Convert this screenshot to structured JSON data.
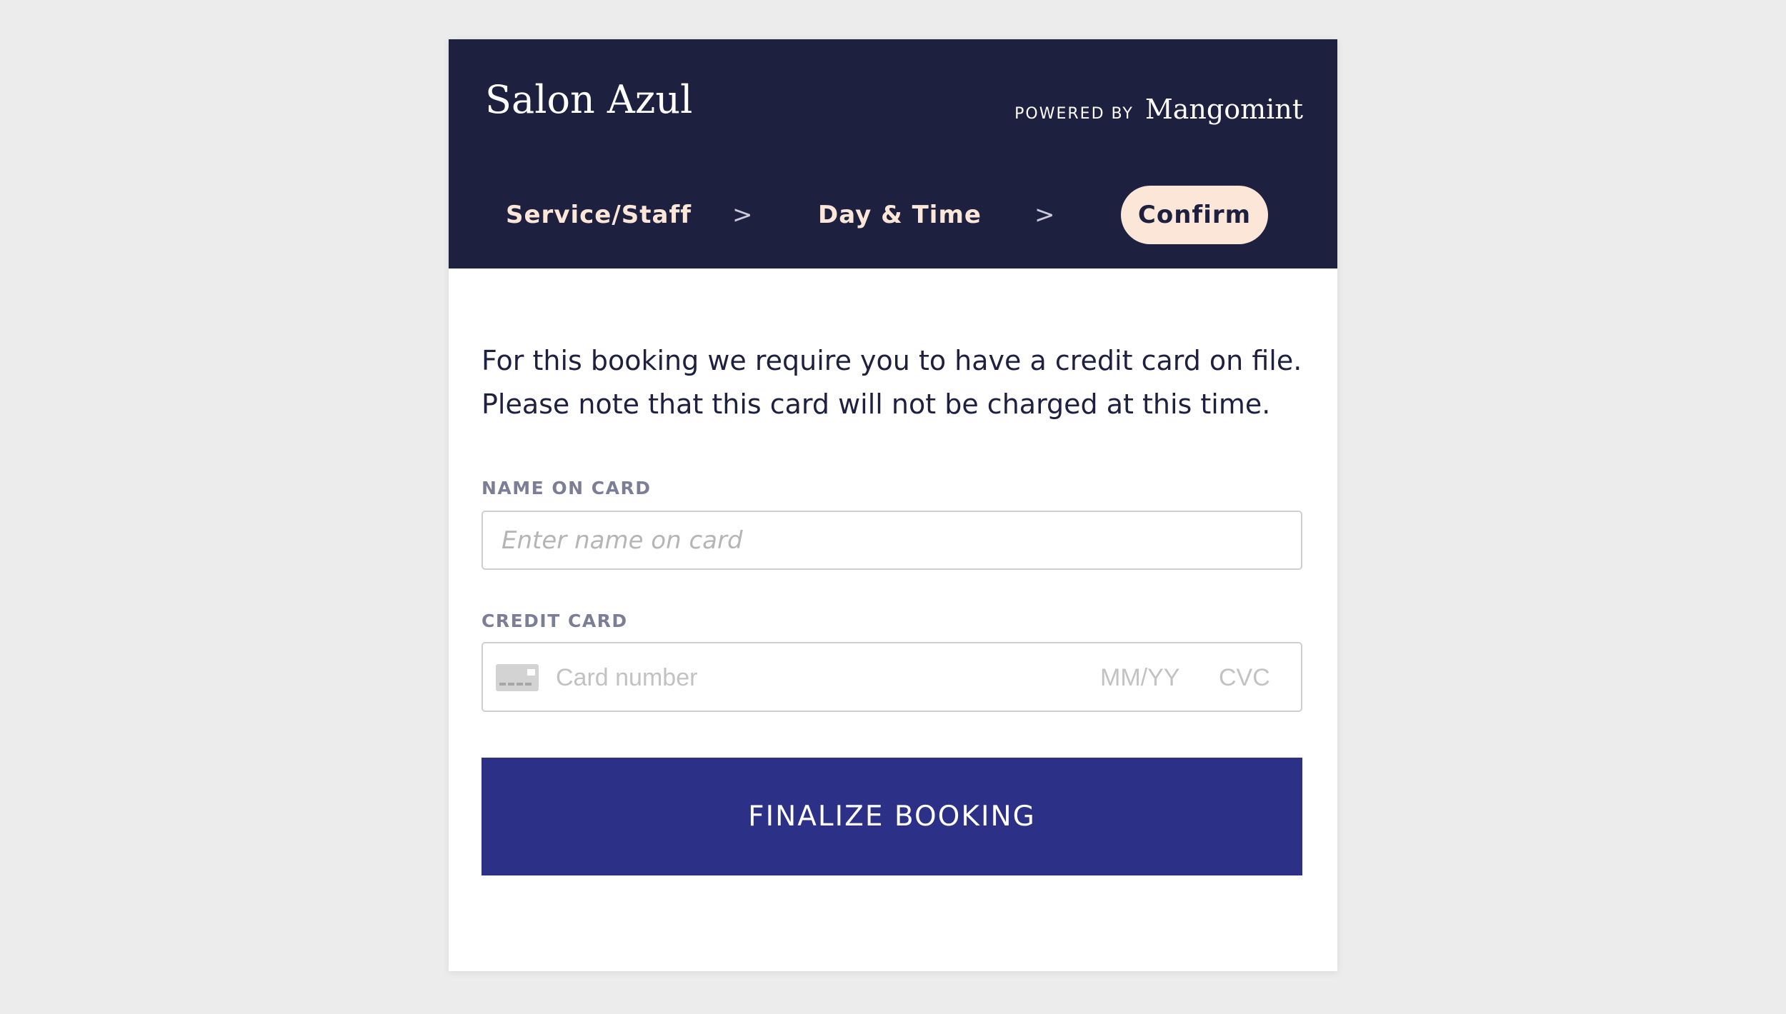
{
  "header": {
    "brand": "Salon Azul",
    "powered_by_label": "POWERED BY",
    "powered_by_logo": "Mangomint"
  },
  "steps": {
    "items": [
      {
        "label": "Service/Staff",
        "active": false
      },
      {
        "label": "Day & Time",
        "active": false
      },
      {
        "label": "Confirm",
        "active": true
      }
    ],
    "separator": ">"
  },
  "notice": {
    "text": "For this booking we require you to have a credit card on file. Please note that this card will not be charged at this time."
  },
  "form": {
    "name_label": "NAME ON CARD",
    "name_placeholder": "Enter name on card",
    "name_value": "",
    "card_label": "CREDIT CARD",
    "card_icon": "credit-card-icon",
    "card_number_placeholder": "Card number",
    "expiry_placeholder": "MM/YY",
    "cvc_placeholder": "CVC"
  },
  "submit": {
    "label": "FINALIZE BOOKING"
  },
  "colors": {
    "header_bg": "#1e2040",
    "active_step_bg": "#fbe6d8",
    "button_bg": "#2c3086",
    "page_bg": "#ececec"
  }
}
